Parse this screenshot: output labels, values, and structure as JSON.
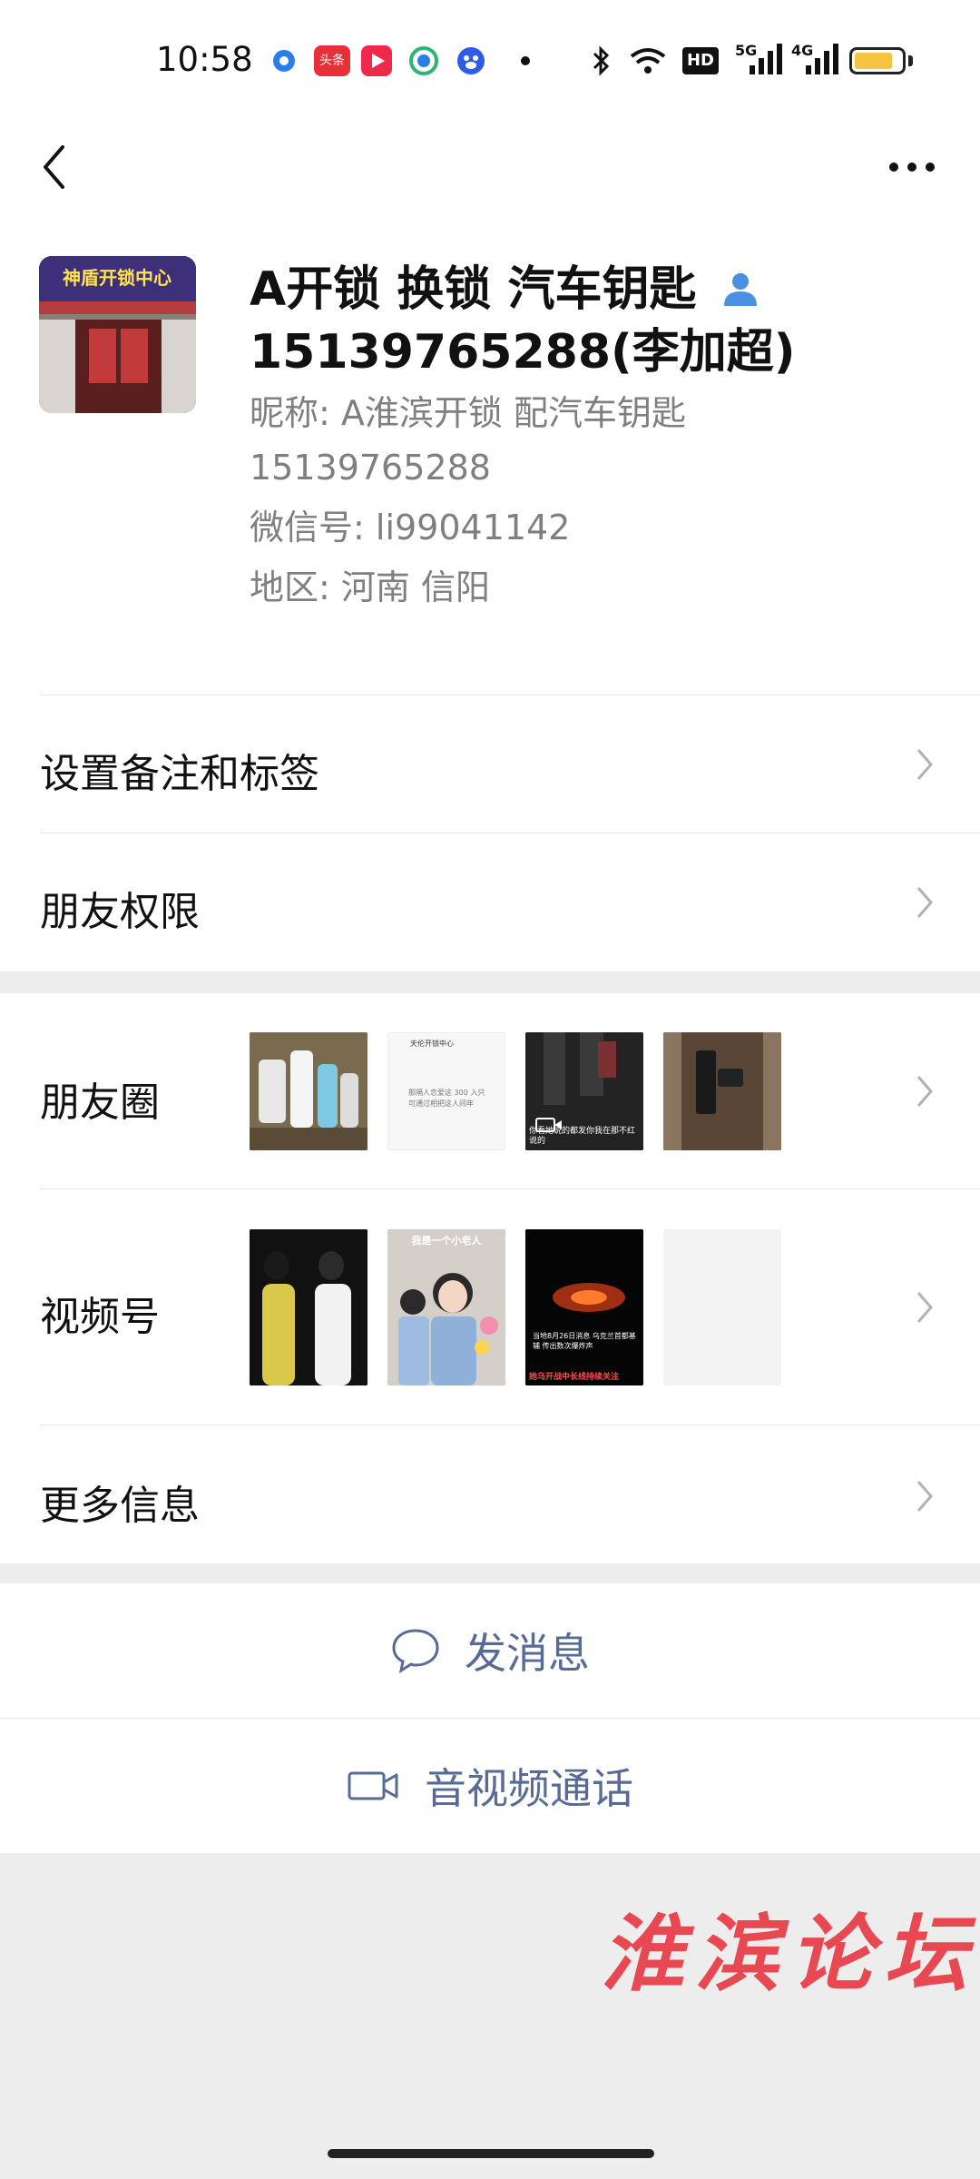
{
  "status_bar": {
    "time": "10:58",
    "app_icons": [
      "dot-app-icon",
      "toutiao-icon",
      "video-app-icon",
      "browser-icon",
      "baidu-icon"
    ],
    "toutiao_label": "头条",
    "network_labels": [
      "HD",
      "5G",
      "4G"
    ]
  },
  "header": {
    "back_icon": "chevron-left-icon",
    "more_icon": "more-dots-icon"
  },
  "profile": {
    "name_line1": "A开锁 换锁 汽车钥匙",
    "name_line2": "15139765288(李加超)",
    "nickname_line1": "昵称: A淮滨开锁 配汽车钥匙",
    "nickname_line2": "15139765288",
    "wechat_id": "微信号: li99041142",
    "region": "地区: 河南  信阳",
    "avatar_sign_text": "神盾开锁中心"
  },
  "menu": {
    "remark_label": "设置备注和标签",
    "permission_label": "朋友权限",
    "moments_label": "朋友圈",
    "channels_label": "视频号",
    "more_info_label": "更多信息"
  },
  "moments_thumbs": {
    "t2_title": "天伦开锁中心",
    "t2_text": "那隔人恋爱这 300 入只可通过相把这人间年",
    "t3_caption": "你看她说的都发你我在那不红说的"
  },
  "channels_thumbs": {
    "c2_caption": "我是一个小老人",
    "c3_caption_top": "当地8月26日消息 乌克兰首都基辅 传出数次爆炸声",
    "c3_caption_bottom": "她乌开战中长线持续关注"
  },
  "actions": {
    "message_label": "发消息",
    "call_label": "音视频通话"
  },
  "watermark": "淮滨论坛",
  "colors": {
    "link": "#576b95",
    "background": "#ededed",
    "battery": "#f6c343",
    "watermark": "#e8404a"
  }
}
